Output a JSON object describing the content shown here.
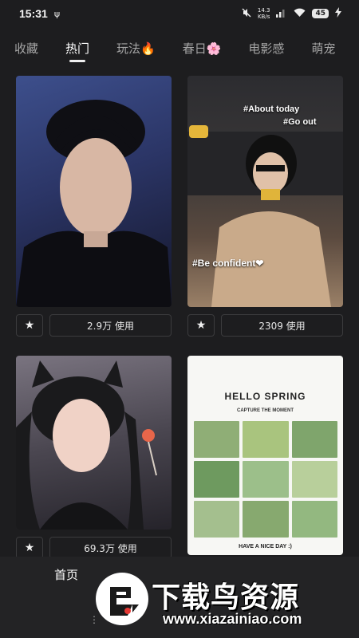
{
  "status_bar": {
    "time": "15:31",
    "usb_icon": "usb-icon",
    "net_speed_value": "14.3",
    "net_speed_unit": "KB/s",
    "battery": "45"
  },
  "tabs": [
    {
      "label": "收藏"
    },
    {
      "label": "热门"
    },
    {
      "label": "玩法🔥"
    },
    {
      "label": "春日🌸"
    },
    {
      "label": "电影感"
    },
    {
      "label": "萌宠"
    }
  ],
  "active_tab": "热门",
  "cards": [
    {
      "use_count": "2.9万 使用",
      "captions": []
    },
    {
      "use_count": "2309 使用",
      "captions": [
        "#About today",
        "#Go out",
        "#Be confident❤"
      ]
    },
    {
      "use_count": "69.3万 使用",
      "captions": []
    },
    {
      "use_count": "",
      "captions": [
        "HELLO SPRING",
        "CAPTURE THE MOMENT",
        "HAVE A NICE DAY :)"
      ]
    }
  ],
  "bottom_nav": {
    "home_label": "首页"
  },
  "watermark": {
    "title": "下载鸟资源",
    "url": "www.xiazainiao.com"
  }
}
